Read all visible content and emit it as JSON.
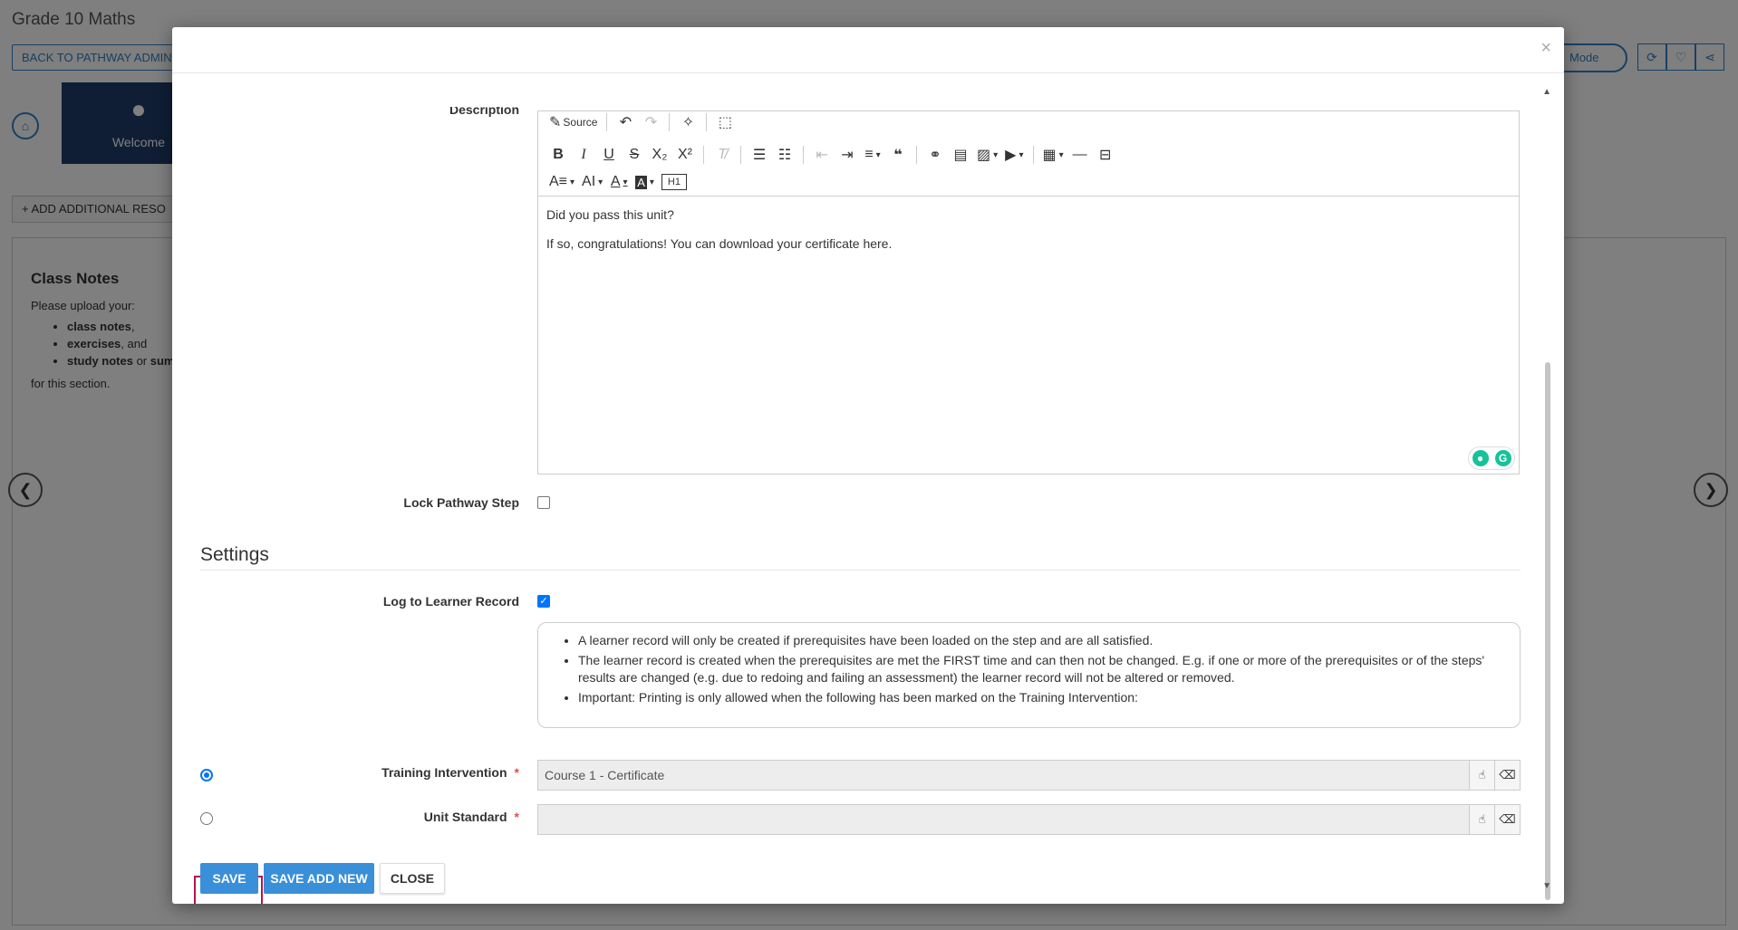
{
  "background": {
    "page_title": "Grade 10 Maths",
    "back_button": "BACK TO PATHWAY ADMIN",
    "mode_button": "Mode",
    "welcome_label": "Welcome",
    "add_resource_button": "+ ADD ADDITIONAL RESO",
    "notes_title": "Class Notes",
    "notes_intro": "Please upload your:",
    "notes_items": [
      {
        "bold": "class notes",
        "rest": ","
      },
      {
        "bold": "exercises",
        "rest": ", and"
      },
      {
        "bold": "study notes",
        "rest": " or ",
        "bold2": "sum"
      }
    ],
    "notes_outro": "for this section."
  },
  "modal": {
    "close_symbol": "×",
    "description_label": "Description",
    "editor": {
      "source_label": "Source",
      "content": [
        "Did you pass this unit?",
        "If so, congratulations! You can download your certificate here."
      ]
    },
    "lock_step_label": "Lock Pathway Step",
    "lock_step_checked": false,
    "settings_title": "Settings",
    "log_learner_label": "Log to Learner Record",
    "log_learner_checked": true,
    "info_items": [
      "A learner record will only be created if prerequisites have been loaded on the step and are all satisfied.",
      "The learner record is created when the prerequisites are met the FIRST time and can then not be changed. E.g. if one or more of the prerequisites or of the steps' results are changed (e.g. due to redoing and failing an assessment) the learner record will not be altered or removed.",
      "Important: Printing is only allowed when the following has been marked on the Training Intervention:"
    ],
    "training_intervention": {
      "label": "Training Intervention",
      "required_mark": "*",
      "value": "Course 1 - Certificate",
      "selected": true
    },
    "unit_standard": {
      "label": "Unit Standard",
      "required_mark": "*",
      "value": "",
      "selected": false
    },
    "buttons": {
      "save": "SAVE",
      "save_add_new": "SAVE ADD NEW",
      "close": "CLOSE"
    }
  },
  "colors": {
    "primary": "#3a8fd9",
    "focus_outline": "#b0164d",
    "required": "#d9534f",
    "welcome_tile": "#1f3d6b"
  }
}
